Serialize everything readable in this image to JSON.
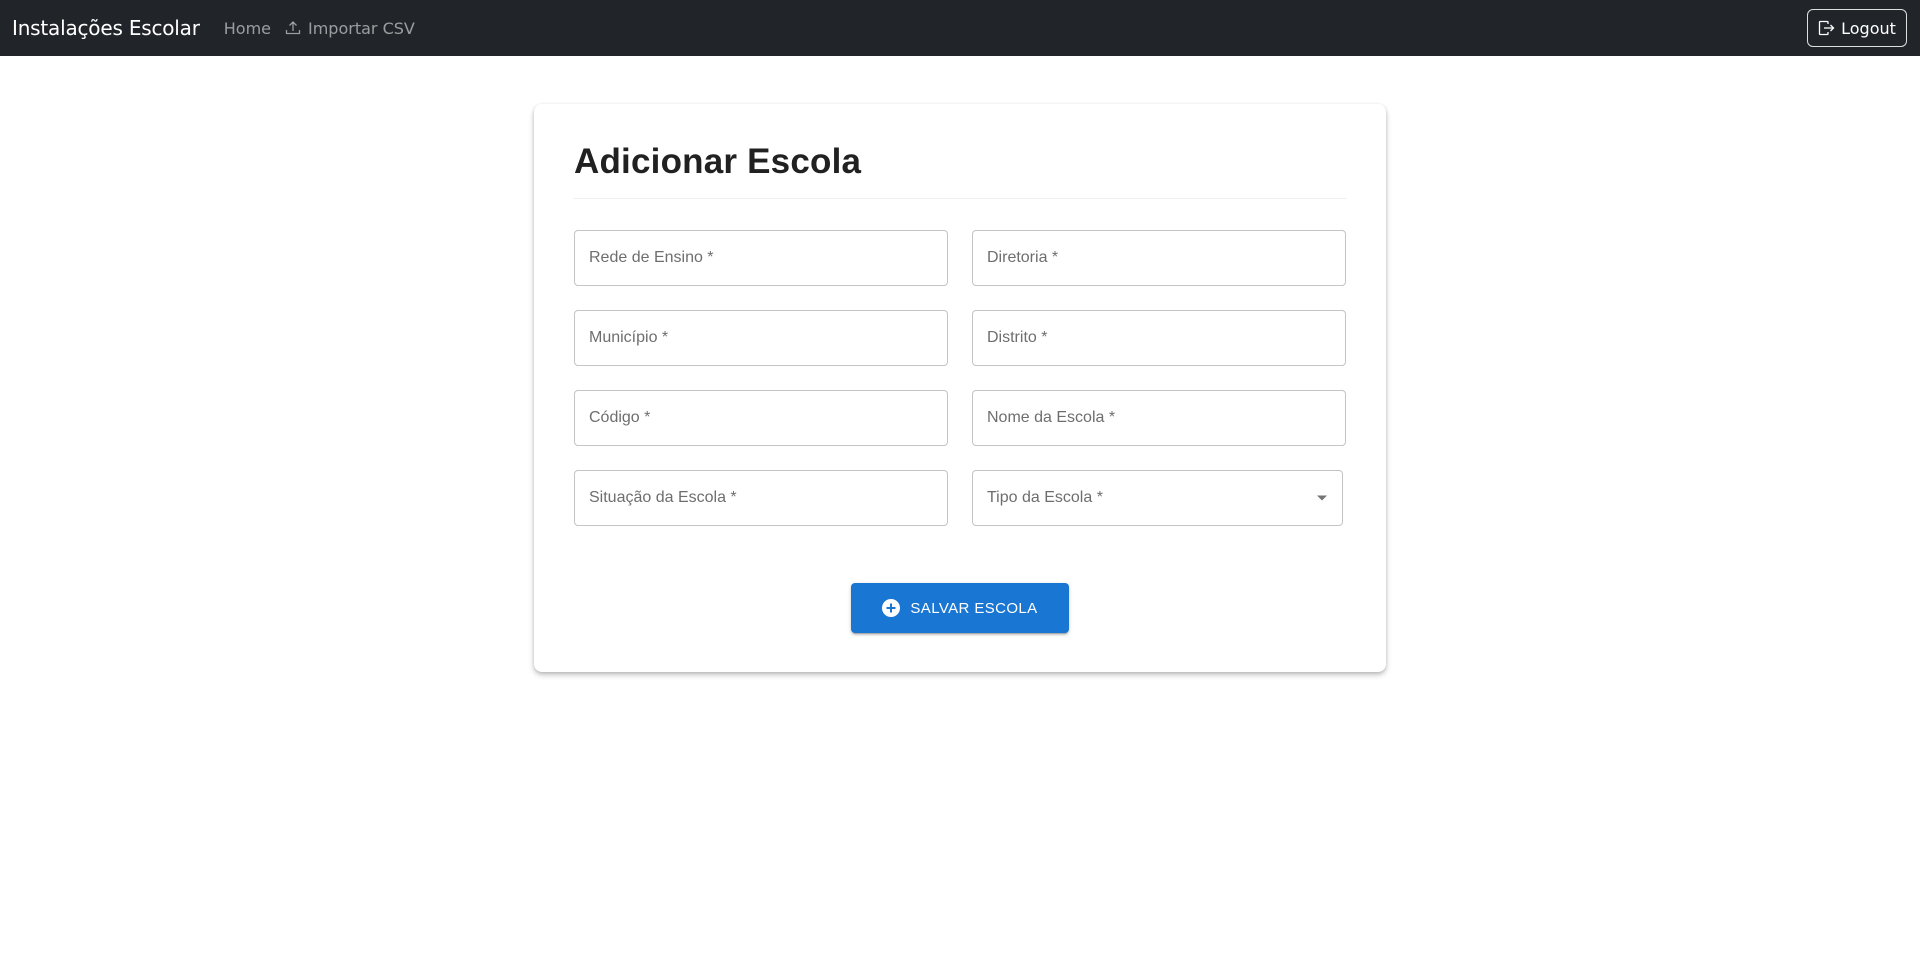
{
  "navbar": {
    "brand": "Instalações Escolar",
    "home": "Home",
    "import_csv": "Importar CSV",
    "logout": "Logout"
  },
  "form": {
    "title": "Adicionar Escola",
    "fields": {
      "rede_de_ensino": {
        "placeholder": "Rede de Ensino *",
        "value": ""
      },
      "diretoria": {
        "placeholder": "Diretoria *",
        "value": ""
      },
      "municipio": {
        "placeholder": "Município *",
        "value": ""
      },
      "distrito": {
        "placeholder": "Distrito *",
        "value": ""
      },
      "codigo": {
        "placeholder": "Código *",
        "value": ""
      },
      "nome_da_escola": {
        "placeholder": "Nome da Escola *",
        "value": ""
      },
      "situacao_da_escola": {
        "placeholder": "Situação da Escola *",
        "value": ""
      },
      "tipo_da_escola": {
        "label": "Tipo da Escola *",
        "selected": ""
      }
    },
    "submit_label": "SALVAR ESCOLA"
  },
  "icons": {
    "upload": "upload-icon",
    "logout": "logout-icon",
    "add": "plus-circle-icon",
    "dropdown": "caret-down-icon"
  },
  "colors": {
    "navbar_bg": "#212529",
    "primary": "#1976d2"
  }
}
